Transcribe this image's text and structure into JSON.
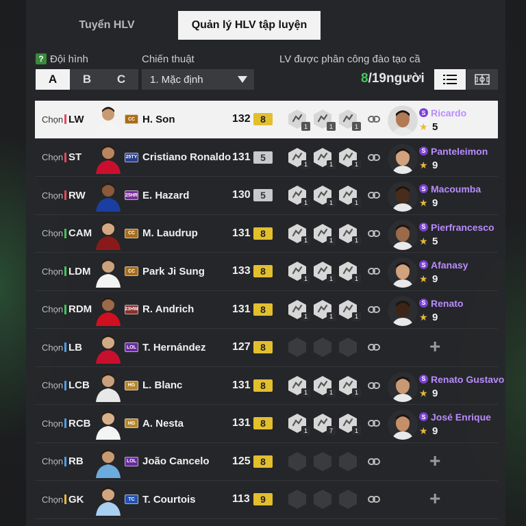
{
  "tabs": [
    {
      "label": "Tuyển HLV",
      "active": false
    },
    {
      "label": "Quản lý HLV tập luyện",
      "active": true
    }
  ],
  "filters": {
    "help_glyph": "?",
    "lineup_label": "Đội hình",
    "lineup_options": [
      "A",
      "B",
      "C"
    ],
    "lineup_selected": "A",
    "tactic_label": "Chiến thuật",
    "tactic_value": "1. Mặc định",
    "assign_label": "LV được phân công đào tạo cầu thủ",
    "assigned": "8",
    "total": "/19",
    "unit": "người"
  },
  "rows": [
    {
      "choose": "Chọn",
      "pos": "LW",
      "pos_color": "#e8455b",
      "season": "CC",
      "season_color": "#a86d1b",
      "name": "H. Son",
      "ovr": "132",
      "grade": "8",
      "grade_type": "gold",
      "skills": [
        1,
        1,
        1
      ],
      "coach": {
        "name": "Ricardo",
        "level": "5"
      }
    },
    {
      "choose": "Chọn",
      "pos": "ST",
      "pos_color": "#e8455b",
      "season": "25TY",
      "season_color": "#2a3f8f",
      "name": "Cristiano Ronaldo",
      "ovr": "131",
      "grade": "5",
      "grade_type": "silver",
      "skills": [
        1,
        1,
        1
      ],
      "coach": {
        "name": "Panteleimon",
        "level": "9"
      }
    },
    {
      "choose": "Chọn",
      "pos": "RW",
      "pos_color": "#e8455b",
      "season": "25HR",
      "season_color": "#7a2f9a",
      "name": "E. Hazard",
      "ovr": "130",
      "grade": "5",
      "grade_type": "silver",
      "skills": [
        1,
        1,
        1
      ],
      "coach": {
        "name": "Macoumba",
        "level": "9"
      }
    },
    {
      "choose": "Chọn",
      "pos": "CAM",
      "pos_color": "#3fc75a",
      "season": "CC",
      "season_color": "#a86d1b",
      "name": "M. Laudrup",
      "ovr": "131",
      "grade": "8",
      "grade_type": "gold",
      "skills": [
        1,
        1,
        1
      ],
      "coach": {
        "name": "Pierfrancesco",
        "level": "5"
      }
    },
    {
      "choose": "Chọn",
      "pos": "LDM",
      "pos_color": "#3fc75a",
      "season": "CC",
      "season_color": "#a86d1b",
      "name": "Park Ji Sung",
      "ovr": "133",
      "grade": "8",
      "grade_type": "gold",
      "skills": [
        1,
        1,
        1
      ],
      "coach": {
        "name": "Afanasy",
        "level": "9"
      }
    },
    {
      "choose": "Chọn",
      "pos": "RDM",
      "pos_color": "#3fc75a",
      "season": "23HW",
      "season_color": "#8b2f2f",
      "name": "R. Andrich",
      "ovr": "131",
      "grade": "8",
      "grade_type": "gold",
      "skills": [
        1,
        1,
        1
      ],
      "coach": {
        "name": "Renato",
        "level": "9"
      }
    },
    {
      "choose": "Chọn",
      "pos": "LB",
      "pos_color": "#4a9fe8",
      "season": "LOL",
      "season_color": "#6a2aa0",
      "name": "T. Hernández",
      "ovr": "127",
      "grade": "8",
      "grade_type": "gold",
      "skills": [],
      "coach": null
    },
    {
      "choose": "Chọn",
      "pos": "LCB",
      "pos_color": "#4a9fe8",
      "season": "HG",
      "season_color": "#b7862a",
      "name": "L. Blanc",
      "ovr": "131",
      "grade": "8",
      "grade_type": "gold",
      "skills": [
        1,
        1,
        1
      ],
      "coach": {
        "name": "Renato Gustavo",
        "level": "9"
      }
    },
    {
      "choose": "Chọn",
      "pos": "RCB",
      "pos_color": "#4a9fe8",
      "season": "HG",
      "season_color": "#b7862a",
      "name": "A. Nesta",
      "ovr": "131",
      "grade": "8",
      "grade_type": "gold",
      "skills": [
        1,
        7,
        1
      ],
      "coach": {
        "name": "José Enrique",
        "level": "9"
      }
    },
    {
      "choose": "Chọn",
      "pos": "RB",
      "pos_color": "#4a9fe8",
      "season": "LOL",
      "season_color": "#6a2aa0",
      "name": "João Cancelo",
      "ovr": "125",
      "grade": "8",
      "grade_type": "gold",
      "skills": [],
      "coach": null
    },
    {
      "choose": "Chọn",
      "pos": "GK",
      "pos_color": "#e6b93a",
      "season": "TC",
      "season_color": "#2352b0",
      "name": "T. Courtois",
      "ovr": "113",
      "grade": "9",
      "grade_type": "gold",
      "skills": [],
      "coach": null
    }
  ],
  "icons": {
    "list_view": "list-icon",
    "pitch_view": "pitch-icon",
    "link": "link-icon",
    "add": "+",
    "star": "★",
    "coach_badge": "S"
  }
}
